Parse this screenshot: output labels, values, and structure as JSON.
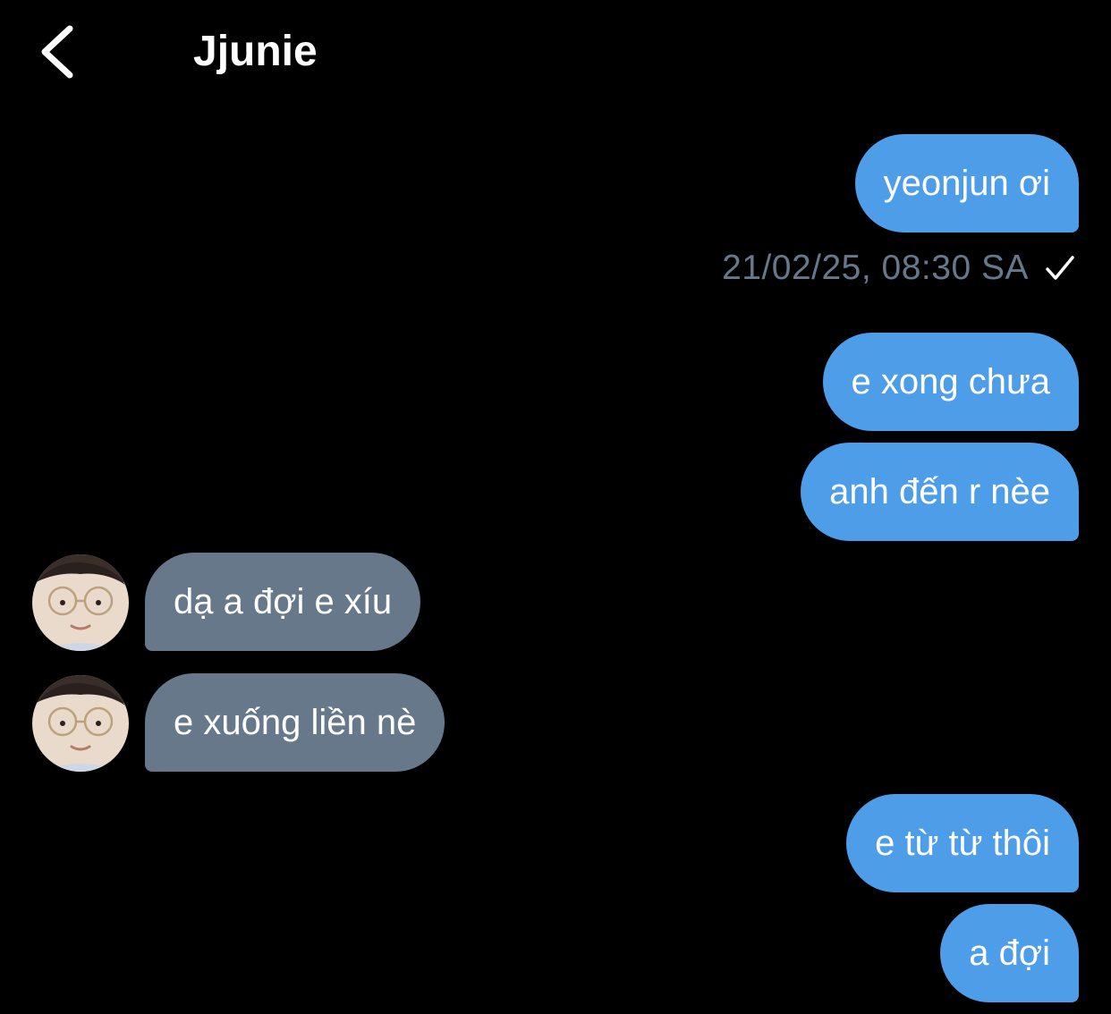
{
  "header": {
    "back_icon": "chevron-left-icon",
    "title": "Jjunie"
  },
  "colors": {
    "background": "#000000",
    "sent_bubble": "#4d9de8",
    "received_bubble": "#66788a",
    "timestamp": "#66788a",
    "text": "#ffffff"
  },
  "messages": [
    {
      "direction": "sent",
      "text": "yeonjun ơi"
    },
    {
      "direction": "sent",
      "text": "e xong chưa"
    },
    {
      "direction": "sent",
      "text": "anh đến r nèe"
    },
    {
      "direction": "received",
      "text": "dạ a đợi e xíu"
    },
    {
      "direction": "received",
      "text": "e xuống liền nè"
    },
    {
      "direction": "sent",
      "text": "e từ từ thôi"
    },
    {
      "direction": "sent",
      "text": "a đợi"
    }
  ],
  "status": {
    "timestamp": "21/02/25, 08:30 SA",
    "read_icon": "checkmark-icon"
  }
}
